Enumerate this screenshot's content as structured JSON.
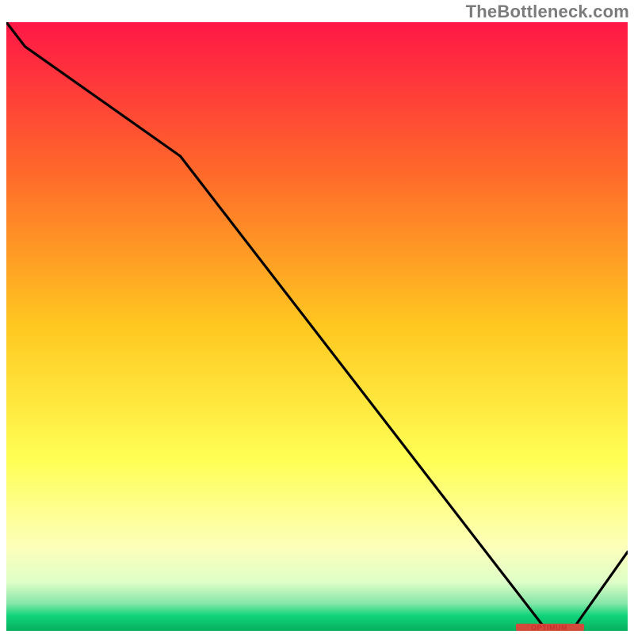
{
  "watermark": "TheBottleneck.com",
  "footnote": "OPTIMUM",
  "chart_data": {
    "type": "line",
    "title": "",
    "xlabel": "",
    "ylabel": "",
    "x": [
      0.0,
      0.03,
      0.28,
      0.87,
      0.91,
      1.0
    ],
    "values": [
      1.0,
      0.96,
      0.78,
      0.0,
      0.0,
      0.13
    ],
    "xlim": [
      0,
      1
    ],
    "ylim": [
      0,
      1
    ],
    "grid": false,
    "legend": false,
    "background": "vertical-gradient-heatmap",
    "gradient_stops": [
      {
        "pos": 0.0,
        "color": "#ff1746"
      },
      {
        "pos": 0.25,
        "color": "#ff6a2a"
      },
      {
        "pos": 0.5,
        "color": "#ffc820"
      },
      {
        "pos": 0.72,
        "color": "#ffff55"
      },
      {
        "pos": 0.86,
        "color": "#fdffb9"
      },
      {
        "pos": 0.92,
        "color": "#dfffc8"
      },
      {
        "pos": 0.955,
        "color": "#85e6a8"
      },
      {
        "pos": 0.975,
        "color": "#11d47a"
      },
      {
        "pos": 1.0,
        "color": "#06b060"
      }
    ],
    "optimum_band": {
      "x0": 0.82,
      "x1": 0.93,
      "y": 0.0
    }
  }
}
